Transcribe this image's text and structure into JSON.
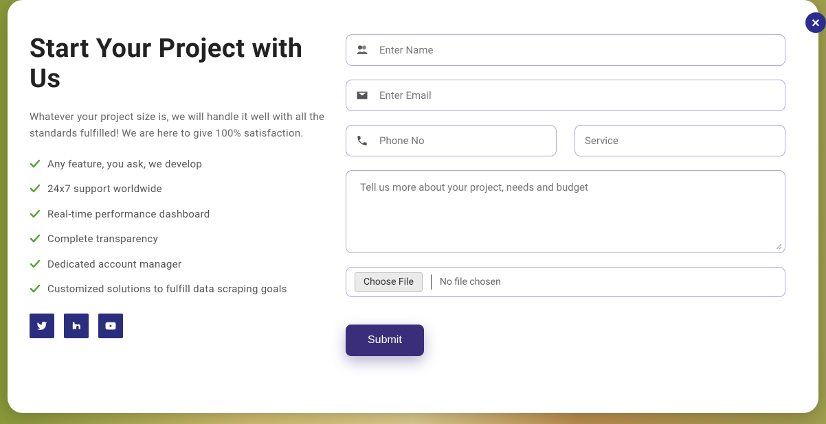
{
  "close_label": "✕",
  "heading": "Start Your Project with Us",
  "description": "Whatever your project size is, we will handle it well with all the standards fulfilled! We are here to give 100% satisfaction.",
  "features": [
    "Any feature, you ask, we develop",
    "24x7 support worldwide",
    "Real-time performance dashboard",
    "Complete transparency",
    "Dedicated account manager",
    "Customized solutions to fulfill data scraping goals"
  ],
  "form": {
    "name_placeholder": "Enter Name",
    "email_placeholder": "Enter Email",
    "phone_placeholder": "Phone No",
    "service_placeholder": "Service",
    "message_placeholder": "Tell us more about your project, needs and budget",
    "choose_file_label": "Choose File",
    "file_status": "No file chosen",
    "submit_label": "Submit"
  },
  "socials": [
    "twitter",
    "linkedin",
    "youtube"
  ]
}
